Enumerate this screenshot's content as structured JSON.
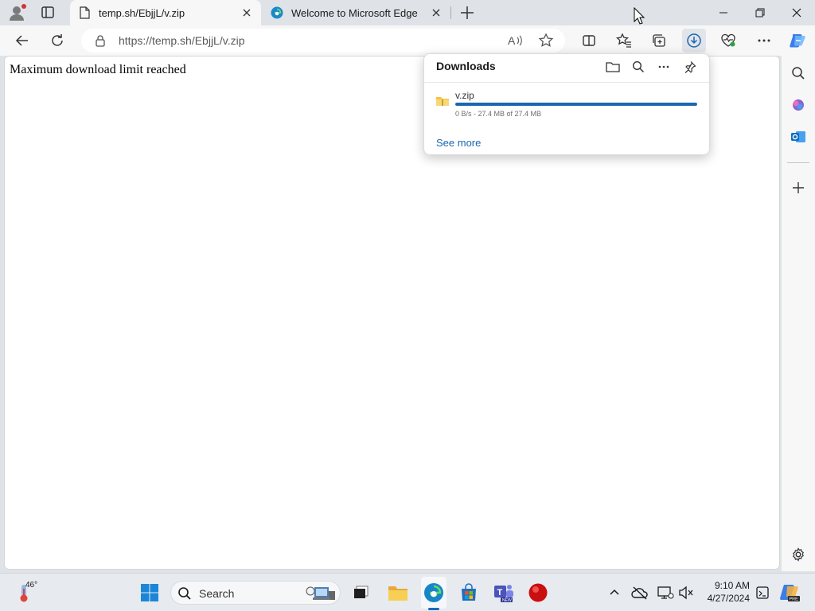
{
  "browser": {
    "tabs": [
      {
        "title": "temp.sh/EbjjL/v.zip",
        "active": true
      },
      {
        "title": "Welcome to Microsoft Edge",
        "active": false
      }
    ],
    "address": {
      "url": "https://temp.sh/EbjjL/v.zip"
    }
  },
  "page": {
    "message": "Maximum download limit reached"
  },
  "downloads": {
    "title": "Downloads",
    "item": {
      "filename": "v.zip",
      "status": "0 B/s - 27.4 MB of 27.4 MB",
      "progress_fraction": 1.0
    },
    "see_more": "See more"
  },
  "taskbar": {
    "weather_temp": "46°",
    "search_label": "Search",
    "time": "9:10 AM",
    "date": "4/27/2024"
  },
  "colors": {
    "accent": "#1a67b0",
    "toolbar": "#f7f7f7",
    "frame": "#dfe3e8"
  }
}
